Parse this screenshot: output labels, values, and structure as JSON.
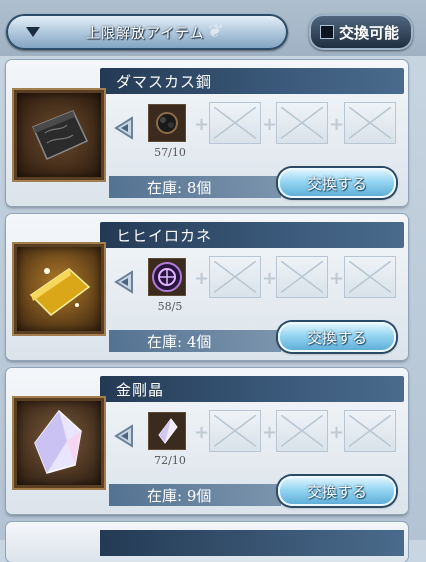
{
  "header": {
    "filter_label": "上限解放アイテム",
    "exchange_toggle_label": "交換可能"
  },
  "items": [
    {
      "name": "ダマスカス鋼",
      "material_count": "57/10",
      "stock": "在庫: 8個",
      "exchange_label": "交換する",
      "item_icon": "damascus-ingot-icon",
      "material_icon": "dark-ore-icon"
    },
    {
      "name": "ヒヒイロカネ",
      "material_count": "58/5",
      "stock": "在庫: 4個",
      "exchange_label": "交換する",
      "item_icon": "gold-ingot-icon",
      "material_icon": "purple-sigil-icon"
    },
    {
      "name": "金剛晶",
      "material_count": "72/10",
      "stock": "在庫: 9個",
      "exchange_label": "交換する",
      "item_icon": "crystal-icon",
      "material_icon": "shard-icon"
    }
  ],
  "colors": {
    "namebar": "#2e4a69",
    "exchange_button": "#8fd3f1",
    "background": "#c3d0dd"
  }
}
